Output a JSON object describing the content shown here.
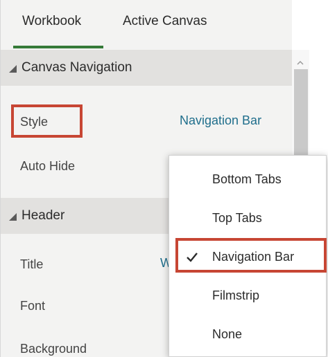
{
  "tabs": [
    {
      "label": "Workbook",
      "active": true
    },
    {
      "label": "Active Canvas",
      "active": false
    }
  ],
  "sections": {
    "canvas_navigation": {
      "title": "Canvas Navigation",
      "style_label": "Style",
      "style_value": "Navigation Bar",
      "auto_hide_label": "Auto Hide"
    },
    "header": {
      "title": "Header",
      "title_label": "Title",
      "title_value_partial": "W",
      "font_label": "Font",
      "background_label": "Background"
    }
  },
  "style_dropdown": {
    "options": [
      {
        "label": "Bottom Tabs",
        "selected": false
      },
      {
        "label": "Top Tabs",
        "selected": false
      },
      {
        "label": "Navigation Bar",
        "selected": true
      },
      {
        "label": "Filmstrip",
        "selected": false
      },
      {
        "label": "None",
        "selected": false
      }
    ]
  },
  "colors": {
    "tab_indicator": "#357a38",
    "link_value": "#1f6e8c",
    "highlight_box": "#c74634",
    "section_header_bg": "#e2e1df"
  },
  "icons": {
    "section_collapse": "triangle-down-icon",
    "selected_option": "checkmark-icon",
    "scroll_up": "chevron-up-icon"
  }
}
